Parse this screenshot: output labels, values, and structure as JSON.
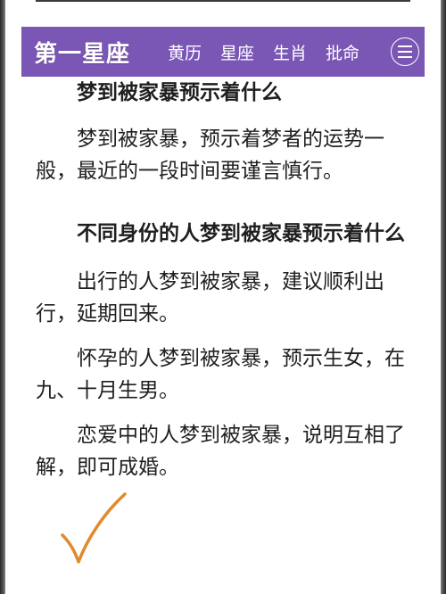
{
  "header": {
    "logo": "第一星座",
    "nav": [
      "黄历",
      "星座",
      "生肖",
      "批命"
    ],
    "menu_icon": "hamburger-icon",
    "color": "#7a56b5"
  },
  "article": {
    "heading1": "梦到被家暴预示着什么",
    "body1": "梦到被家暴，预示着梦者的运势一般，最近的一段时间要谨言慎行。",
    "heading2": "不同身份的人梦到被家暴预示着什么",
    "body2": "出行的人梦到被家暴，建议顺利出行，延期回来。",
    "body3": "怀孕的人梦到被家暴，预示生女，在九、十月生男。",
    "body4": "恋爱中的人梦到被家暴，说明互相了解，即可成婚。"
  },
  "annotation": {
    "icon": "handwritten-checkmark-icon",
    "color": "#e08a2e"
  }
}
